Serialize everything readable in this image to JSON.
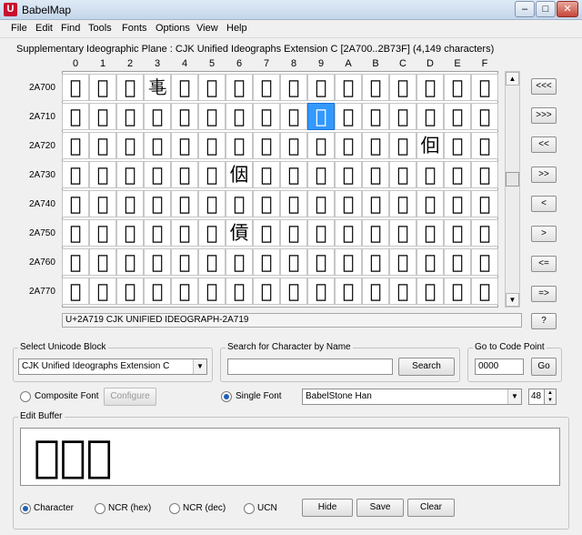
{
  "window": {
    "title": "BabelMap",
    "app_icon": "U",
    "minimize": "–",
    "maximize": "□",
    "close": "✕"
  },
  "menu": [
    "File",
    "Edit",
    "Find",
    "Tools",
    "Fonts",
    "Options",
    "View",
    "Help"
  ],
  "plane_title": "Supplementary Ideographic Plane : CJK Unified Ideographs Extension C [2A700..2B73F] (4,149 characters)",
  "columns": [
    "0",
    "1",
    "2",
    "3",
    "4",
    "5",
    "6",
    "7",
    "8",
    "9",
    "A",
    "B",
    "C",
    "D",
    "E",
    "F"
  ],
  "rows": [
    {
      "label": "2A700",
      "chars": [
        "𪜀",
        "𪜁",
        "𪜂",
        "𪜃",
        "𪜄",
        "𪜅",
        "𪜆",
        "𪜇",
        "𪜈",
        "𪜉",
        "𪜊",
        "𪜋",
        "𪜌",
        "𪜍",
        "𪜎",
        "𪜏"
      ]
    },
    {
      "label": "2A710",
      "chars": [
        "𪜐",
        "𪜑",
        "𪜒",
        "𪜓",
        "𪜔",
        "𪜕",
        "𪜖",
        "𪜗",
        "𪜘",
        "𪜙",
        "𪜚",
        "𪜛",
        "𪜜",
        "𪜝",
        "𪜞",
        "𪜟"
      ]
    },
    {
      "label": "2A720",
      "chars": [
        "𪜠",
        "𪜡",
        "𪜢",
        "𪜣",
        "𪜤",
        "𪜥",
        "𪜦",
        "𪜧",
        "𪜨",
        "𪜩",
        "𪜪",
        "𪜫",
        "𪜬",
        "𪜭",
        "𪜮",
        "𪜯"
      ]
    },
    {
      "label": "2A730",
      "chars": [
        "𪜰",
        "𪜱",
        "𪜲",
        "𪜳",
        "𪜴",
        "𪜵",
        "𪜶",
        "𪜷",
        "𪜸",
        "𪜹",
        "𪜺",
        "𪜻",
        "𪜼",
        "𪜽",
        "𪜾",
        "𪜿"
      ]
    },
    {
      "label": "2A740",
      "chars": [
        "𪝀",
        "𪝁",
        "𪝂",
        "𪝃",
        "𪝄",
        "𪝅",
        "𪝆",
        "𪝇",
        "𪝈",
        "𪝉",
        "𪝊",
        "𪝋",
        "𪝌",
        "𪝍",
        "𪝎",
        "𪝏"
      ]
    },
    {
      "label": "2A750",
      "chars": [
        "𪝐",
        "𪝑",
        "𪝒",
        "𪝓",
        "𪝔",
        "𪝕",
        "𪝖",
        "𪝗",
        "𪝘",
        "𪝙",
        "𪝚",
        "𪝛",
        "𪝜",
        "𪝝",
        "𪝞",
        "𪝟"
      ]
    },
    {
      "label": "2A760",
      "chars": [
        "𪝠",
        "𪝡",
        "𪝢",
        "𪝣",
        "𪝤",
        "𪝥",
        "𪝦",
        "𪝧",
        "𪝨",
        "𪝩",
        "𪝪",
        "𪝫",
        "𪝬",
        "𪝭",
        "𪝮",
        "𪝯"
      ]
    },
    {
      "label": "2A770",
      "chars": [
        "𪝰",
        "𪝱",
        "𪝲",
        "𪝳",
        "𪝴",
        "𪝵",
        "𪝶",
        "𪝷",
        "𪝸",
        "𪝹",
        "𪝺",
        "𪝻",
        "𪝼",
        "𪝽",
        "𪝾",
        "𪝿"
      ]
    }
  ],
  "selected_cell": {
    "row": 1,
    "col": 9
  },
  "nav_buttons": [
    "<<<",
    ">>>",
    "<<",
    ">>",
    "<",
    ">",
    "<=",
    "=>",
    "?"
  ],
  "status_text": "U+2A719 CJK UNIFIED IDEOGRAPH-2A719",
  "unicode_block": {
    "label": "Select Unicode Block",
    "value": "CJK Unified Ideographs Extension C"
  },
  "search": {
    "label": "Search for Character by Name",
    "value": "",
    "button": "Search"
  },
  "goto": {
    "label": "Go to Code Point",
    "value": "0000",
    "button": "Go"
  },
  "font": {
    "composite_label": "Composite Font",
    "configure_label": "Configure",
    "single_label": "Single Font",
    "single_selected": true,
    "font_name": "BabelStone Han",
    "size": "48"
  },
  "edit_buffer": {
    "label": "Edit Buffer",
    "text": "𪜄𪝼𪜙"
  },
  "output_mode": {
    "options": [
      "Character",
      "NCR (hex)",
      "NCR (dec)",
      "UCN"
    ],
    "selected": 0
  },
  "buttons": {
    "hide": "Hide",
    "save": "Save",
    "clear": "Clear"
  },
  "colors": {
    "selection": "#3399ff",
    "titlebar": "#c5d6ea"
  },
  "icons": {
    "scroll_up": "▲",
    "scroll_down": "▼",
    "dropdown": "▼",
    "spin_up": "▲",
    "spin_down": "▼"
  }
}
